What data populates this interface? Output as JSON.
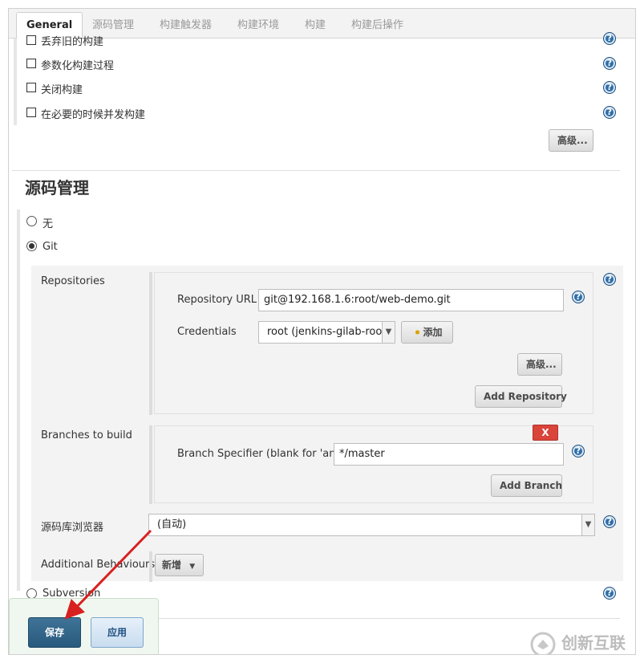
{
  "tabs": [
    {
      "label": "General",
      "active": true
    },
    {
      "label": "源码管理"
    },
    {
      "label": "构建触发器"
    },
    {
      "label": "构建环境"
    },
    {
      "label": "构建"
    },
    {
      "label": "构建后操作"
    }
  ],
  "general": {
    "options": [
      {
        "label": "丢弃旧的构建",
        "checked": false
      },
      {
        "label": "参数化构建过程",
        "checked": false
      },
      {
        "label": "关闭构建",
        "checked": false
      },
      {
        "label": "在必要的时候并发构建",
        "checked": false
      }
    ],
    "advanced_label": "高级..."
  },
  "scm": {
    "title": "源码管理",
    "none_label": "无",
    "git_label": "Git",
    "subversion_label": "Subversion",
    "repositories_label": "Repositories",
    "repo_url_label": "Repository URL",
    "repo_url_value": "git@192.168.1.6:root/web-demo.git",
    "credentials_label": "Credentials",
    "credentials_value": "root (jenkins-gilab-root)",
    "add_credentials_label": "添加",
    "repo_advanced_label": "高级...",
    "add_repository_label": "Add Repository",
    "branches_label": "Branches to build",
    "delete_label": "X",
    "branch_specifier_label": "Branch Specifier (blank for 'any')",
    "branch_specifier_value": "*/master",
    "add_branch_label": "Add Branch",
    "browser_label": "源码库浏览器",
    "browser_value": "(自动)",
    "additional_label": "Additional Behaviours",
    "add_new_label": "新增"
  },
  "footer": {
    "save_label": "保存",
    "apply_label": "应用"
  },
  "watermark": {
    "text": "创新互联"
  },
  "colors": {
    "save": "#285a7d",
    "apply": "#c8dcef",
    "delete": "#d9443b",
    "help": "#2e6ea8",
    "arrow": "#d82020"
  }
}
